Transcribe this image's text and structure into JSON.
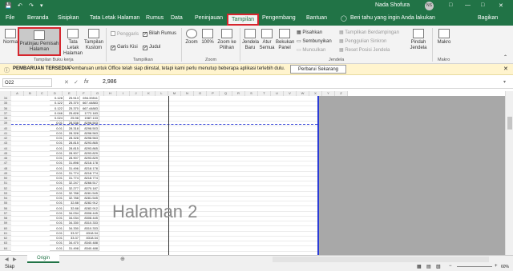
{
  "titlebar": {
    "user": "Nada Shofura",
    "initials": "NS"
  },
  "tabs": [
    {
      "label": "File"
    },
    {
      "label": "Beranda"
    },
    {
      "label": "Sisipkan"
    },
    {
      "label": "Tata Letak Halaman"
    },
    {
      "label": "Rumus"
    },
    {
      "label": "Data"
    },
    {
      "label": "Peninjauan"
    },
    {
      "label": "Tampilan"
    },
    {
      "label": "Pengembang"
    },
    {
      "label": "Bantuan"
    }
  ],
  "tell_me": "Beri tahu yang ingin Anda lakukan",
  "share": "Bagikan",
  "ribbon": {
    "workbook_views": {
      "group": "Tampilan Buku kerja",
      "normal": "Normal",
      "page_break": "Pratinjau Pemisah Halaman",
      "page_layout": "Tata Letak Halaman",
      "custom": "Tampilan Kustom"
    },
    "show": {
      "group": "Tampilkan",
      "ruler": "Penggaris",
      "formula_bar": "Bilah Rumus",
      "gridlines": "Garis Kisi",
      "headings": "Judul"
    },
    "zoom": {
      "group": "Zoom",
      "zoom": "Zoom",
      "hundred": "100%",
      "zoom_selection": "Zoom ke Pilihan"
    },
    "window": {
      "group": "Jendela",
      "new_window": "Jendela Baru",
      "arrange_all": "Atur Semua",
      "freeze": "Bekukan Panel",
      "split": "Pisahkan",
      "hide": "Sembunyikan",
      "unhide": "Munculkan",
      "side_by_side": "Tampilkan Berdampingan",
      "sync_scroll": "Penggulian Sinkron",
      "reset_pos": "Reset Posisi Jendela",
      "switch": "Pindah Jendela"
    },
    "macros": {
      "group": "Makro",
      "macros": "Makro"
    }
  },
  "message_bar": {
    "title": "PEMBARUAN TERSEDIA",
    "text": "Pembaruan untuk Office telah siap diinstal, tetapi kami perlu menutup beberapa aplikasi terlebih dulu.",
    "button": "Perbarui Sekarang"
  },
  "formula_bar": {
    "cell_ref": "O22",
    "fx": "fx",
    "value": "2,986"
  },
  "sheet": {
    "watermark": "Halaman 2",
    "columns": [
      "A",
      "B",
      "C",
      "D",
      "E",
      "F",
      "G",
      "H",
      "I",
      "J",
      "K",
      "L",
      "M",
      "N",
      "O",
      "P",
      "Q",
      "R",
      "S",
      "T",
      "U",
      "V",
      "W",
      "X",
      "Y",
      "Z"
    ],
    "rows": [
      {
        "n": "34",
        "a": "0.128",
        "b": "25.513",
        "c": "694.33511"
      },
      {
        "n": "35",
        "a": "0.122",
        "b": "25.370",
        "c": "667.44883"
      },
      {
        "n": "36",
        "a": "0.122",
        "b": "25.370",
        "c": "667.44883"
      },
      {
        "n": "37",
        "a": "0.046",
        "b": "25.828",
        "c": "1772.183"
      },
      {
        "n": "38",
        "a": "0.024",
        "b": "25.98",
        "c": "1987.133"
      },
      {
        "n": "39",
        "a": "0.01",
        "b": "28.538",
        "c": "8298.503"
      },
      {
        "n": "40",
        "a": "0.01",
        "b": "28.318",
        "c": "8298.503"
      },
      {
        "n": "41",
        "a": "0.01",
        "b": "28.328",
        "c": "8298.563"
      },
      {
        "n": "42",
        "a": "0.01",
        "b": "28.328",
        "c": "8298.563"
      },
      {
        "n": "43",
        "a": "0.01",
        "b": "28.815",
        "c": "8293.865"
      },
      {
        "n": "44",
        "a": "0.01",
        "b": "28.815",
        "c": "8293.865"
      },
      {
        "n": "45",
        "a": "0.01",
        "b": "28.907",
        "c": "8293.829"
      },
      {
        "n": "46",
        "a": "0.01",
        "b": "28.907",
        "c": "8293.829"
      },
      {
        "n": "47",
        "a": "0.01",
        "b": "31.898",
        "c": "8218.178"
      },
      {
        "n": "48",
        "a": "0.01",
        "b": "31.496",
        "c": "8218.178"
      },
      {
        "n": "49",
        "a": "0.01",
        "b": "31.774",
        "c": "8218.774"
      },
      {
        "n": "50",
        "a": "0.01",
        "b": "31.774",
        "c": "8218.774"
      },
      {
        "n": "51",
        "a": "0.01",
        "b": "32.247",
        "c": "8268.517"
      },
      {
        "n": "52",
        "a": "0.01",
        "b": "32.277",
        "c": "8270.187"
      },
      {
        "n": "53",
        "a": "0.01",
        "b": "32.788",
        "c": "8281.545"
      },
      {
        "n": "54",
        "a": "0.01",
        "b": "32.788",
        "c": "8281.545"
      },
      {
        "n": "55",
        "a": "0.01",
        "b": "32.88",
        "c": "8282.912"
      },
      {
        "n": "56",
        "a": "0.01",
        "b": "32.88",
        "c": "8282.912"
      },
      {
        "n": "57",
        "a": "0.01",
        "b": "34.034",
        "c": "8308.445"
      },
      {
        "n": "58",
        "a": "0.01",
        "b": "34.034",
        "c": "8308.445"
      },
      {
        "n": "59",
        "a": "0.01",
        "b": "34.330",
        "c": "8310.333"
      },
      {
        "n": "60",
        "a": "0.01",
        "b": "34.330",
        "c": "8310.333"
      },
      {
        "n": "61",
        "a": "0.01",
        "b": "33.37",
        "c": "8318.34"
      },
      {
        "n": "62",
        "a": "0.01",
        "b": "33.37",
        "c": "8318.34"
      },
      {
        "n": "63",
        "a": "0.01",
        "b": "34.470",
        "c": "8340.488"
      },
      {
        "n": "64",
        "a": "0.01",
        "b": "31.498",
        "c": "8340.488"
      }
    ]
  },
  "sheet_tab": "Origin",
  "status": {
    "ready": "Siap",
    "zoom": "60%"
  }
}
